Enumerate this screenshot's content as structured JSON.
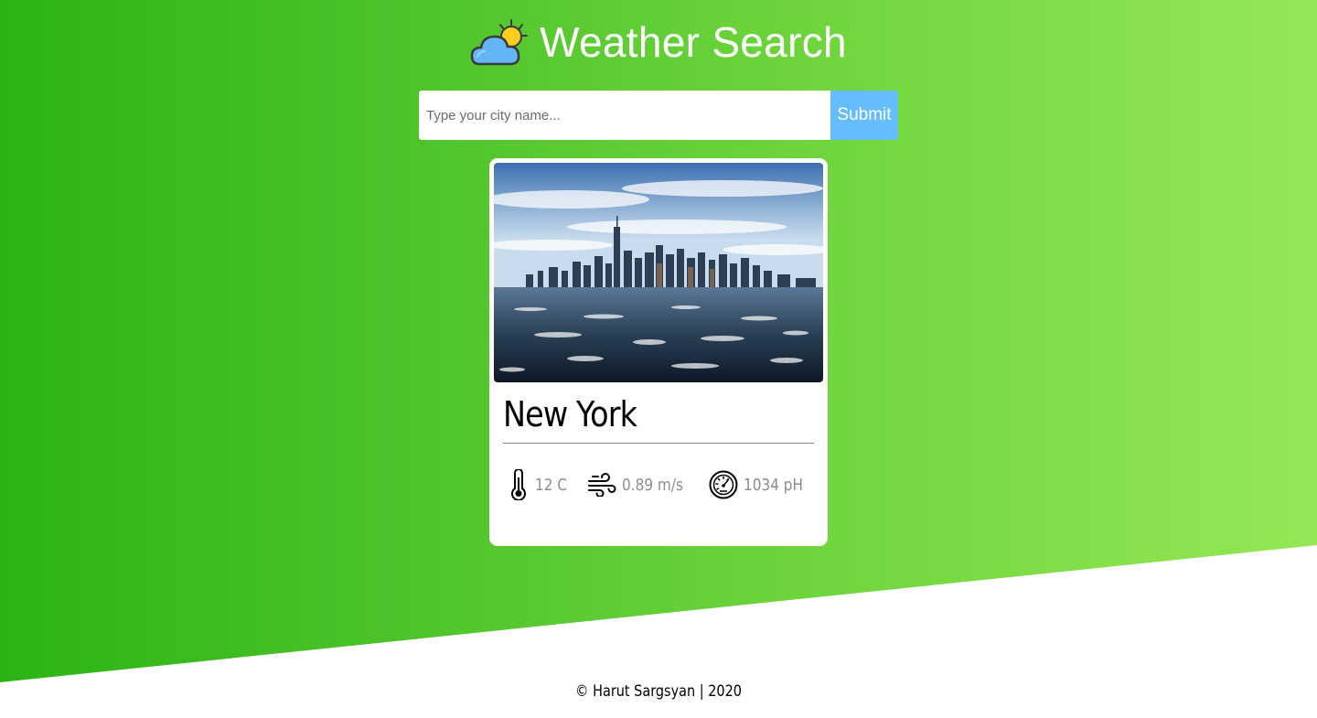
{
  "header": {
    "title": "Weather Search",
    "logo_icon": "sun-behind-cloud-icon"
  },
  "search": {
    "placeholder": "Type your city name...",
    "value": "",
    "submit_label": "Submit"
  },
  "card": {
    "image": "new-york-skyline-photo",
    "city": "New York",
    "stats": {
      "temperature": "12 C",
      "wind": "0.89 m/s",
      "pressure": "1034 pH"
    },
    "icons": {
      "temperature": "thermometer-icon",
      "wind": "wind-icon",
      "pressure": "gauge-icon"
    }
  },
  "footer": {
    "text": "© Harut Sargsyan | 2020"
  },
  "colors": {
    "gradient_start": "#2bb414",
    "gradient_end": "#95e853",
    "submit_button": "#66bdfd",
    "card": "#ffffff"
  }
}
